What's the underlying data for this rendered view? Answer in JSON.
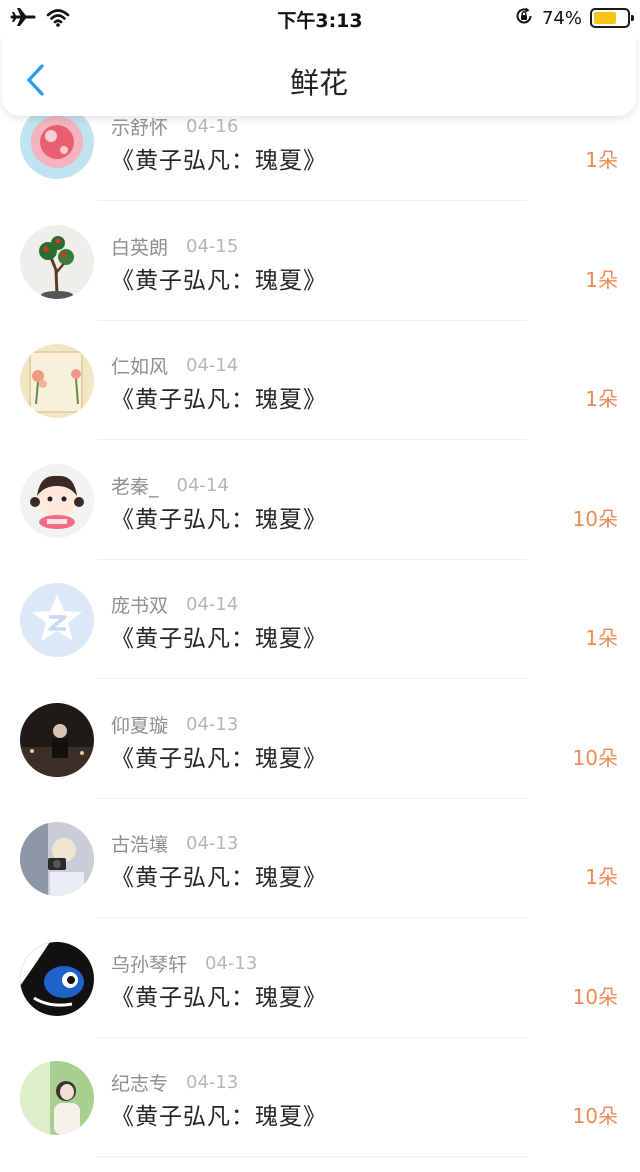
{
  "status_bar": {
    "time": "下午3:13",
    "battery_percent": "74%",
    "battery_level": 0.74,
    "icons": [
      "airplane-icon",
      "wifi-icon",
      "rotation-lock-icon",
      "battery-icon"
    ]
  },
  "header": {
    "title": "鲜花",
    "back_icon": "chevron-left-icon"
  },
  "colors": {
    "accent": "#ee8b55",
    "back": "#2d9cf0",
    "battery": "#f5c518"
  },
  "gifts": [
    {
      "name": "示舒怀",
      "date": "04-16",
      "item": "《黄子弘凡：瑰夏》",
      "qty": "1朵",
      "avatar": "pink-gem-avatar"
    },
    {
      "name": "白英朗",
      "date": "04-15",
      "item": "《黄子弘凡：瑰夏》",
      "qty": "1朵",
      "avatar": "bonsai-tree-avatar"
    },
    {
      "name": "仁如风",
      "date": "04-14",
      "item": "《黄子弘凡：瑰夏》",
      "qty": "1朵",
      "avatar": "flowers-wall-avatar"
    },
    {
      "name": "老秦_",
      "date": "04-14",
      "item": "《黄子弘凡：瑰夏》",
      "qty": "10朵",
      "avatar": "cartoon-girl-avatar"
    },
    {
      "name": "庞书双",
      "date": "04-14",
      "item": "《黄子弘凡：瑰夏》",
      "qty": "1朵",
      "avatar": "default-z-avatar"
    },
    {
      "name": "仰夏璇",
      "date": "04-13",
      "item": "《黄子弘凡：瑰夏》",
      "qty": "10朵",
      "avatar": "dark-room-avatar"
    },
    {
      "name": "古浩壤",
      "date": "04-13",
      "item": "《黄子弘凡：瑰夏》",
      "qty": "1朵",
      "avatar": "camera-person-avatar"
    },
    {
      "name": "乌孙琴轩",
      "date": "04-13",
      "item": "《黄子弘凡：瑰夏》",
      "qty": "10朵",
      "avatar": "blue-fish-avatar"
    },
    {
      "name": "纪志专",
      "date": "04-13",
      "item": "《黄子弘凡：瑰夏》",
      "qty": "10朵",
      "avatar": "green-window-avatar"
    }
  ]
}
